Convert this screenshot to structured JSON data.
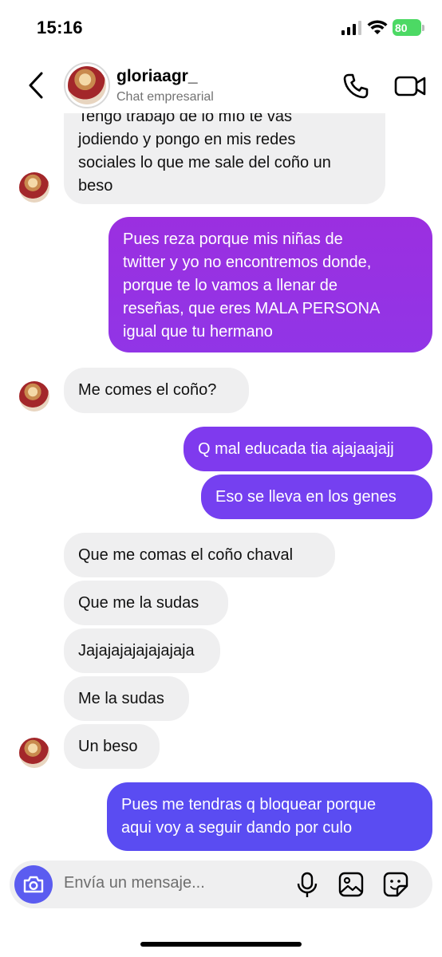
{
  "status_bar": {
    "time": "15:16",
    "battery": "80"
  },
  "header": {
    "username": "gloriaagr_",
    "subtitle": "Chat empresarial",
    "icons": [
      "chevron-left-icon",
      "phone-icon",
      "video-camera-icon"
    ]
  },
  "messages": [
    {
      "side": "in",
      "text": "Tengo trabajo de lo mío te vas\njodiendo y pongo en mis redes\nsociales lo que me sale del coño un\nbeso"
    },
    {
      "side": "out",
      "text": "Pues reza porque mis niñas de\ntwitter y yo no encontremos donde,\nporque te lo vamos a llenar de\nreseñas, que eres MALA PERSONA\nigual que tu hermano"
    },
    {
      "side": "in",
      "text": "Me comes el coño?"
    },
    {
      "side": "out",
      "text": "Q mal educada tia ajajaajajj"
    },
    {
      "side": "out",
      "text": "Eso se lleva en los genes"
    },
    {
      "side": "in",
      "text": "Que me comas el coño chaval"
    },
    {
      "side": "in",
      "text": "Que me la sudas"
    },
    {
      "side": "in",
      "text": "Jajajajajajajajaja"
    },
    {
      "side": "in",
      "text": "Me la sudas"
    },
    {
      "side": "in",
      "text": "Un beso"
    },
    {
      "side": "out",
      "text": "Pues me tendras q bloquear porque\naqui voy a seguir dando por culo"
    }
  ],
  "composer": {
    "placeholder": "Envía un mensaje...",
    "icons": [
      "camera-icon",
      "microphone-icon",
      "gallery-icon",
      "sticker-icon"
    ]
  },
  "colors": {
    "incoming_bubble": "#efeff0",
    "outgoing_top": "#9b2fe0",
    "outgoing_mid": "#7b3cf0",
    "outgoing_bottom": "#5a4cf2",
    "camera_button": "#5b5cf0"
  }
}
